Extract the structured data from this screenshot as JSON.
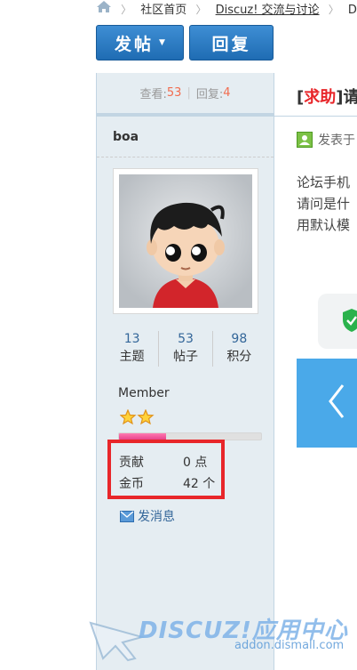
{
  "breadcrumb": {
    "items": [
      "社区首页",
      "Discuz! 交流与讨论",
      "Di"
    ]
  },
  "toolbar": {
    "post_label": "发帖",
    "reply_label": "回复"
  },
  "sidebar": {
    "views_label": "查看:",
    "views": "53",
    "replies_label": "回复:",
    "replies": "4",
    "username": "boa",
    "stats": [
      {
        "value": "13",
        "label": "主题"
      },
      {
        "value": "53",
        "label": "帖子"
      },
      {
        "value": "98",
        "label": "积分"
      }
    ],
    "group": "Member",
    "star_count": 2,
    "level_progress": 0.33,
    "contribution_label": "贡献",
    "contribution_value": "0 点",
    "coins_label": "金币",
    "coins_value": "42 个",
    "message_label": "发消息"
  },
  "post": {
    "tag_open": "[",
    "tag": "求助",
    "tag_close": "]",
    "title_fragment": "请",
    "posted_label": "发表于",
    "body_lines": [
      "论坛手机",
      "请问是什",
      "用默认模"
    ]
  },
  "watermark": {
    "logo": "DISCUZ!应用中心",
    "url": "addon.dismall.com"
  },
  "colors": {
    "accent_blue": "#1f6cb3",
    "highlight_red": "#e8262a",
    "count_orange": "#f26c4f",
    "link_blue": "#336699",
    "panel_blue": "#4aa9e9"
  }
}
